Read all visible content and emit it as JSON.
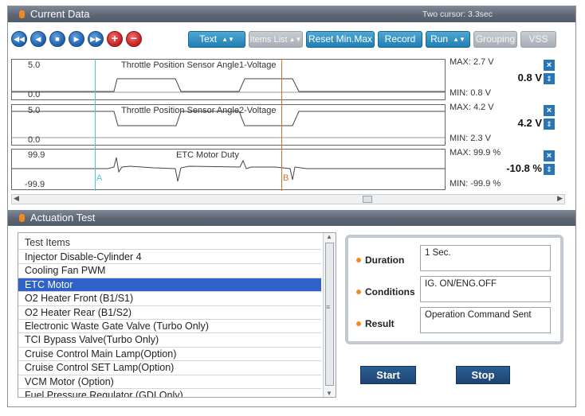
{
  "current_data": {
    "title": "Current Data",
    "cursor_info": "Two cursor: 3.3sec"
  },
  "toolbar": {
    "text_label": "Text",
    "items_list_label": "Items List",
    "reset_label": "Reset Min.Max",
    "record_label": "Record",
    "run_label": "Run",
    "grouping_label": "Grouping",
    "vss_label": "VSS"
  },
  "graphs": [
    {
      "name": "Throttle Position Sensor Angle1-Voltage",
      "ymax_label": "5.0",
      "ymin_label": "0.0",
      "max": "MAX:   2.7 V",
      "min": "MIN:   0.8 V",
      "current": "0.8 V",
      "trace": "tps1"
    },
    {
      "name": "Throttle Position Sensor Angle2-Voltage",
      "ymax_label": "5.0",
      "ymin_label": "0.0",
      "max": "MAX:   4.2 V",
      "min": "MIN:   2.3 V",
      "current": "4.2 V",
      "trace": "tps2"
    },
    {
      "name": "ETC Motor Duty",
      "ymax_label": "99.9",
      "ymin_label": "-99.9",
      "max": "MAX:   99.9 %",
      "min": "MIN:  -99.9 %",
      "current": "-10.8 %",
      "trace": "etc"
    }
  ],
  "cursors": {
    "a_label": "A",
    "b_label": "B",
    "a_color": "#4fc3d8",
    "b_color": "#e06a2a"
  },
  "actuation": {
    "title": "Actuation Test",
    "list_header": "Test Items",
    "items": [
      "Injector Disable-Cylinder 4",
      "Cooling Fan PWM",
      "ETC Motor",
      "O2 Heater Front (B1/S1)",
      "O2 Heater Rear (B1/S2)",
      "Electronic Waste Gate Valve (Turbo Only)",
      "TCI Bypass Valve(Turbo Only)",
      "Cruise Control Main Lamp(Option)",
      "Cruise Control SET Lamp(Option)",
      "VCM Motor (Option)",
      "Fuel Pressure Regulator (GDI Only)"
    ],
    "selected_item": "ETC Motor",
    "duration_label": "Duration",
    "duration_value": "1 Sec.",
    "conditions_label": "Conditions",
    "conditions_value": "IG. ON/ENG.OFF",
    "result_label": "Result",
    "result_value": "Operation Command Sent",
    "start_label": "Start",
    "stop_label": "Stop"
  },
  "colors": {
    "header": "#5c6674",
    "button_blue": "#1f7fb3",
    "accent_orange": "#f08a22",
    "selection": "#2e62c6",
    "action_button": "#1d4472"
  }
}
